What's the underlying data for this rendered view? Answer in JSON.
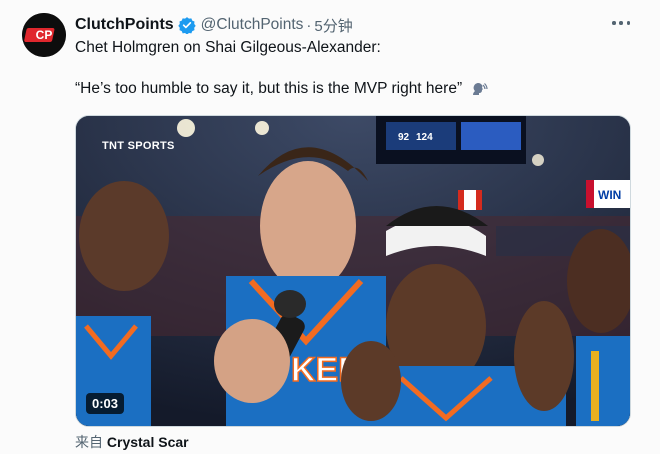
{
  "author": {
    "display_name": "ClutchPoints",
    "handle": "@ClutchPoints",
    "separator": "·",
    "time": "5分钟",
    "avatar_text": "CP"
  },
  "tweet": {
    "line1": "Chet Holmgren on Shai Gilgeous-Alexander:",
    "line2": "“He’s too humble to say it, but this is the MVP right here”"
  },
  "media": {
    "timestamp": "0:03",
    "broadcaster_logo": "TNT SPORTS",
    "scoreboard": [
      "92",
      "124"
    ],
    "jersey_text": "KER",
    "banner_text": "WIN"
  },
  "source": {
    "prefix": "来自",
    "name": "Crystal Scar"
  },
  "colors": {
    "brand_red": "#e0272d",
    "verified_blue": "#1d9bf0",
    "text": "#0f1419",
    "muted": "#536471"
  }
}
